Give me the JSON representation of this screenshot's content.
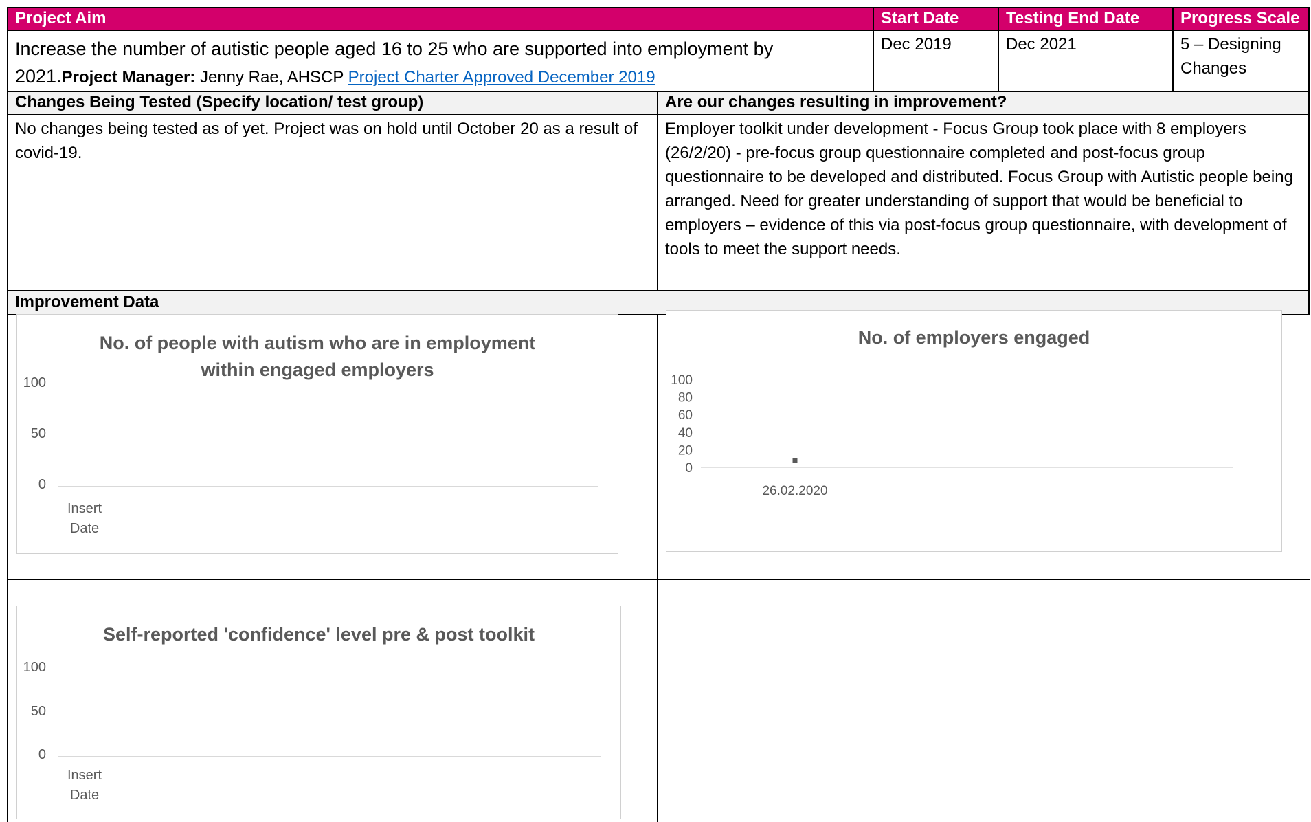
{
  "header": {
    "project_aim_label": "Project Aim",
    "start_date_label": "Start Date",
    "testing_end_date_label": "Testing End Date",
    "progress_scale_label": "Progress Scale"
  },
  "aim": {
    "text": "Increase the number of autistic people aged 16 to 25 who are supported into employment by 2021.",
    "manager_label": "Project Manager:",
    "manager_value": " Jenny Rae, AHSCP ",
    "charter_link": "Project Charter Approved December 2019",
    "start_date": "Dec 2019",
    "end_date": "Dec 2021",
    "progress_line1": "5 – Designing",
    "progress_line2": "Changes"
  },
  "changes": {
    "tested_label": "Changes Being Tested (Specify location/ test group)",
    "improvement_label": "Are our changes resulting in improvement?",
    "tested_text": "No changes being tested as of yet. Project was on hold until October 20 as a result of covid-19.",
    "improvement_text": "Employer toolkit under development - Focus Group took place with 8 employers (26/2/20) - pre-focus group questionnaire completed and post-focus group questionnaire to be developed and distributed.  Focus Group with Autistic people being arranged.  Need for greater understanding of support that would be beneficial to employers – evidence of this via post-focus group questionnaire, with development of tools to meet the support needs."
  },
  "improvement_data_label": "Improvement Data",
  "chart_data": [
    {
      "type": "line",
      "title": "No. of people with autism who are in employment within engaged employers",
      "title_line1": "No. of people with autism who are in employment",
      "title_line2": "within engaged employers",
      "categories": [
        "Insert Date"
      ],
      "x_label_line1": "Insert",
      "x_label_line2": "Date",
      "yticks": [
        "100",
        "50",
        "0"
      ],
      "ylim": [
        0,
        100
      ],
      "series": []
    },
    {
      "type": "scatter",
      "title": "No. of employers engaged",
      "categories": [
        "26.02.2020"
      ],
      "yticks": [
        "100",
        "80",
        "60",
        "40",
        "20",
        "0"
      ],
      "ylim": [
        0,
        100
      ],
      "series": [
        {
          "values": [
            8
          ]
        }
      ],
      "marker_color": "#595959"
    },
    {
      "type": "line",
      "title": "Self-reported 'confidence' level pre & post toolkit",
      "categories": [
        "Insert Date"
      ],
      "x_label_line1": "Insert",
      "x_label_line2": "Date",
      "yticks": [
        "100",
        "50",
        "0"
      ],
      "ylim": [
        0,
        100
      ],
      "series": []
    }
  ]
}
